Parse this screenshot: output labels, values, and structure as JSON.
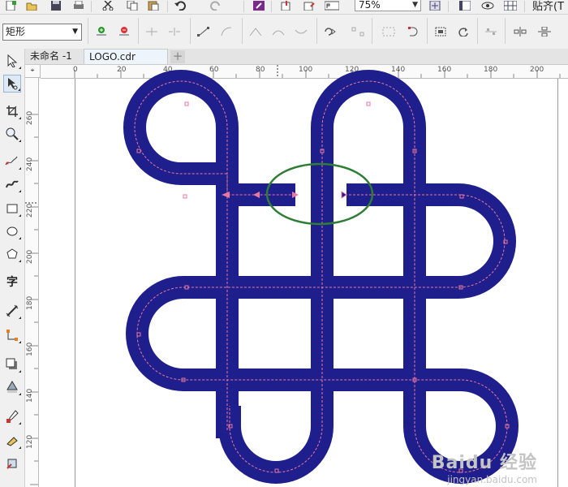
{
  "toolbar": {
    "zoom_value": "75%",
    "snap_label": "贴齐(T",
    "shape_type": "矩形"
  },
  "document_tabs": [
    {
      "label": "未命名 -1",
      "active": false
    },
    {
      "label": "LOGO.cdr",
      "active": true
    }
  ],
  "add_tab_symbol": "+",
  "ruler": {
    "horizontal_ticks": [
      "0",
      "20",
      "40",
      "60",
      "80",
      "100",
      "120",
      "140",
      "160",
      "180",
      "200"
    ],
    "vertical_ticks": [
      "260",
      "240",
      "220",
      "200",
      "180",
      "160",
      "140",
      "120"
    ],
    "corner_symbol": "⌖"
  },
  "colors": {
    "shape_fill": "#1e1e8c",
    "node_path": "#e8789f",
    "highlight_ellipse": "#2f7d36",
    "active_tab": "#eef4fb"
  },
  "toolbox": {
    "active_tool": "shape-tool",
    "text_tool_glyph": "字"
  },
  "watermark": {
    "brand": "Baidu 经验",
    "url": "jingyan.baidu.com"
  }
}
